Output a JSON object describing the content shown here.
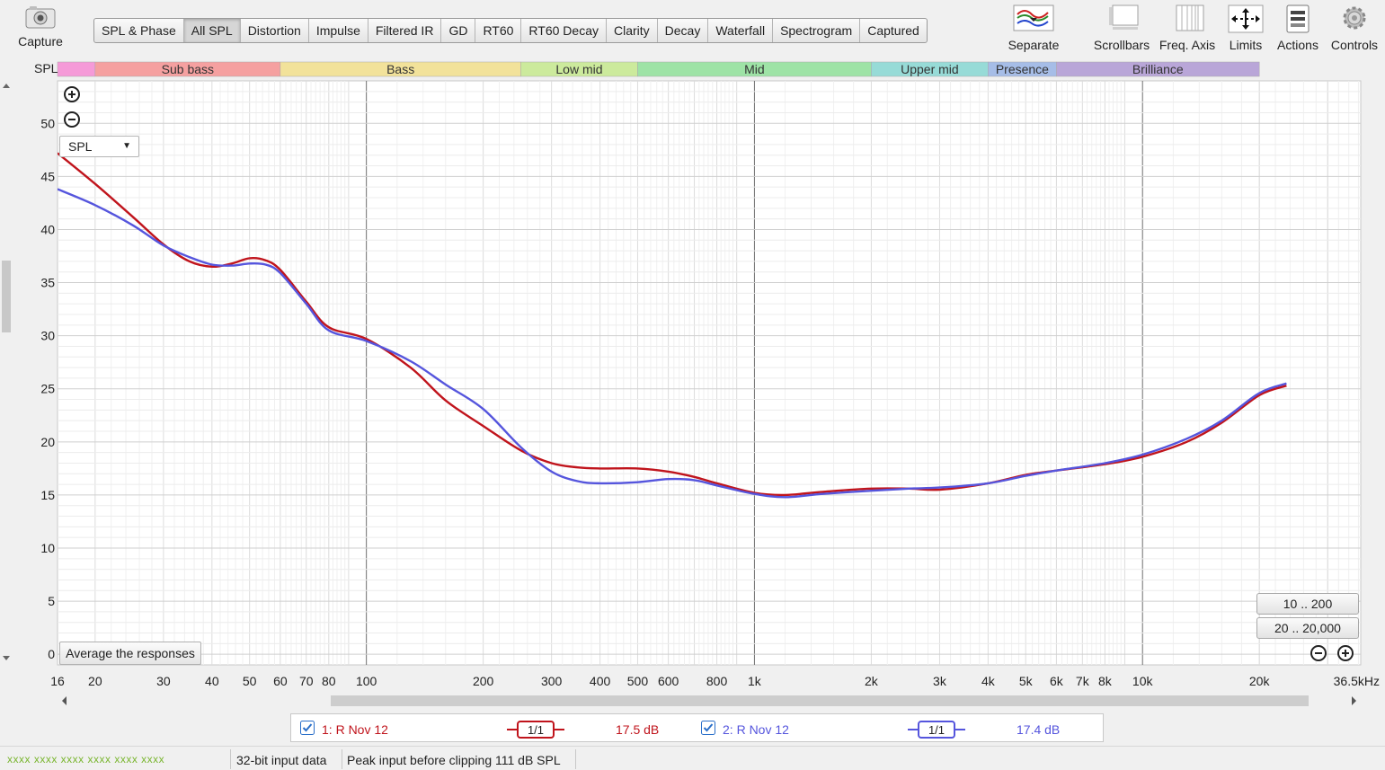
{
  "toolbar": {
    "capture_label": "Capture",
    "tabs": [
      "SPL & Phase",
      "All SPL",
      "Distortion",
      "Impulse",
      "Filtered IR",
      "GD",
      "RT60",
      "RT60 Decay",
      "Clarity",
      "Decay",
      "Waterfall",
      "Spectrogram",
      "Captured"
    ],
    "active_tab": "All SPL",
    "right": {
      "separate": "Separate",
      "scrollbars": "Scrollbars",
      "freq_axis": "Freq. Axis",
      "limits": "Limits",
      "actions": "Actions",
      "controls": "Controls"
    }
  },
  "bands": {
    "label": "SPL",
    "items": [
      {
        "name": "",
        "color": "#f59ad8"
      },
      {
        "name": "Sub bass",
        "color": "#f5a0a0"
      },
      {
        "name": "Bass",
        "color": "#f2e29a"
      },
      {
        "name": "Low mid",
        "color": "#ccea9c"
      },
      {
        "name": "Mid",
        "color": "#9ee3a6"
      },
      {
        "name": "Upper mid",
        "color": "#97dbd7"
      },
      {
        "name": "Presence",
        "color": "#a6bde7"
      },
      {
        "name": "Brilliance",
        "color": "#b9a6d8"
      }
    ]
  },
  "plot": {
    "dropdown_value": "SPL",
    "average_button": "Average the responses",
    "range_buttons": [
      "10 .. 200",
      "20 .. 20,000"
    ],
    "y_ticks": [
      "0",
      "5",
      "10",
      "15",
      "20",
      "25",
      "30",
      "35",
      "40",
      "45",
      "50"
    ],
    "x_ticks": [
      "16",
      "20",
      "30",
      "40",
      "50",
      "60",
      "70",
      "80",
      "100",
      "200",
      "300",
      "400",
      "500",
      "600",
      "800",
      "1k",
      "2k",
      "3k",
      "4k",
      "5k",
      "6k",
      "7k",
      "8k",
      "10k",
      "20k",
      "36.5kHz"
    ]
  },
  "chart_data": {
    "type": "line",
    "xlabel": "",
    "ylabel": "SPL",
    "x_scale": "log",
    "xlim": [
      16,
      36500
    ],
    "ylim": [
      -1,
      54
    ],
    "grid": true,
    "series": [
      {
        "name": "1: R Nov 12",
        "color": "#c0141c",
        "x": [
          16,
          20,
          25,
          30,
          35,
          40,
          45,
          50,
          55,
          60,
          70,
          80,
          100,
          130,
          160,
          200,
          250,
          300,
          350,
          400,
          500,
          600,
          700,
          800,
          1000,
          1200,
          1500,
          2000,
          2500,
          3000,
          4000,
          5000,
          6000,
          8000,
          10000,
          13000,
          16000,
          20000,
          23500
        ],
        "y": [
          47.2,
          44.3,
          41.2,
          38.6,
          37.0,
          36.5,
          36.8,
          37.3,
          37.1,
          36.2,
          33.2,
          30.8,
          29.7,
          27.0,
          23.9,
          21.5,
          19.2,
          18.0,
          17.6,
          17.5,
          17.5,
          17.2,
          16.7,
          16.1,
          15.2,
          15.0,
          15.3,
          15.6,
          15.6,
          15.5,
          16.1,
          16.9,
          17.3,
          17.9,
          18.6,
          20.0,
          21.8,
          24.4,
          25.3
        ]
      },
      {
        "name": "2: R Nov 12",
        "color": "#5555dd",
        "x": [
          16,
          20,
          25,
          30,
          35,
          40,
          45,
          50,
          55,
          60,
          70,
          80,
          100,
          130,
          160,
          200,
          250,
          300,
          350,
          400,
          500,
          600,
          700,
          800,
          1000,
          1200,
          1500,
          2000,
          2500,
          3000,
          4000,
          5000,
          6000,
          8000,
          10000,
          13000,
          16000,
          20000,
          23500
        ],
        "y": [
          43.8,
          42.3,
          40.4,
          38.5,
          37.4,
          36.7,
          36.6,
          36.8,
          36.7,
          35.9,
          33.0,
          30.5,
          29.5,
          27.6,
          25.4,
          23.1,
          19.5,
          17.2,
          16.3,
          16.1,
          16.2,
          16.5,
          16.4,
          15.9,
          15.1,
          14.8,
          15.1,
          15.4,
          15.6,
          15.7,
          16.1,
          16.8,
          17.3,
          18.0,
          18.8,
          20.3,
          22.0,
          24.6,
          25.5
        ]
      }
    ]
  },
  "legend": {
    "item1_name": "1: R Nov 12",
    "item1_smoothing": "1/1",
    "item1_value": "17.5 dB",
    "item1_color": "#c0141c",
    "item2_name": "2: R Nov 12",
    "item2_smoothing": "1/1",
    "item2_value": "17.4 dB",
    "item2_color": "#5555dd"
  },
  "status": {
    "meters": "xxxx xxxx  xxxx xxxx  xxxx xxxx",
    "input_data": "32-bit input data",
    "peak": "Peak input before clipping 111 dB SPL"
  }
}
